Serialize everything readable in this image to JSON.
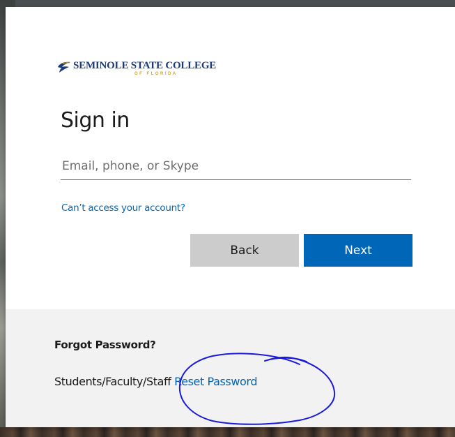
{
  "brand": {
    "name": "SEMINOLE STATE COLLEGE",
    "sub": "OF FLORIDA",
    "primary_color": "#1b3a7a",
    "accent_color": "#d9a424",
    "logo_icon": "seminole-swoosh-icon"
  },
  "signin": {
    "title": "Sign in",
    "email_placeholder": "Email, phone, or Skype",
    "cant_access_link": "Can’t access your account?",
    "back_label": "Back",
    "next_label": "Next",
    "link_color": "#0067b8"
  },
  "footer": {
    "heading": "Forgot Password?",
    "prefix": "Students/Faculty/Staff ",
    "reset_link": "Reset Password"
  },
  "annotation": {
    "icon": "hand-drawn-circle-icon",
    "color": "#1a1adb"
  }
}
